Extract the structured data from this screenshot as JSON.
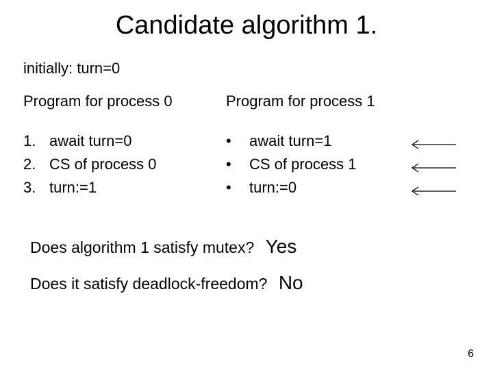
{
  "title": "Candidate algorithm 1.",
  "initial": "initially: turn=0",
  "left": {
    "heading": "Program for process 0",
    "rows": [
      {
        "bullet": "1.",
        "text": "await  turn=0"
      },
      {
        "bullet": "2.",
        "text": "CS of process 0"
      },
      {
        "bullet": "3.",
        "text": "turn:=1"
      }
    ]
  },
  "right": {
    "heading": "Program for process 1",
    "rows": [
      {
        "bullet": "•",
        "text": "await  turn=1"
      },
      {
        "bullet": "•",
        "text": "CS of process 1"
      },
      {
        "bullet": "•",
        "text": "turn:=0"
      }
    ]
  },
  "q1": {
    "question": "Does algorithm 1 satisfy mutex?",
    "answer": "Yes"
  },
  "q2": {
    "question": "Does it satisfy deadlock-freedom?",
    "answer": "No"
  },
  "page": "6"
}
